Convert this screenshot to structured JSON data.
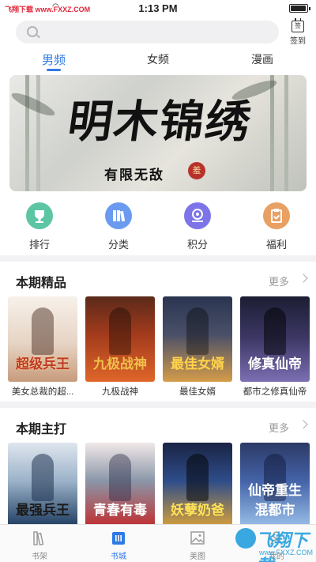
{
  "status_bar": {
    "carrier": "飞翔下载 www.FXXZ.COM",
    "time": "1:13 PM"
  },
  "search": {
    "placeholder": "",
    "icon": "search-icon"
  },
  "checkin": {
    "icon_char": "签",
    "label": "签到"
  },
  "tabs": [
    {
      "label": "男频",
      "active": true
    },
    {
      "label": "女频",
      "active": false
    },
    {
      "label": "漫画",
      "active": false
    }
  ],
  "banner": {
    "title": "明木锦绣",
    "author_line": "有限无敌",
    "seal": "羞"
  },
  "quick_nav": [
    {
      "label": "排行",
      "icon": "trophy-icon",
      "color": "#5cc6a4"
    },
    {
      "label": "分类",
      "icon": "books-icon",
      "color": "#6b9bf0"
    },
    {
      "label": "积分",
      "icon": "points-icon",
      "color": "#7d74e8"
    },
    {
      "label": "福利",
      "icon": "gift-clipboard-icon",
      "color": "#e8a064"
    }
  ],
  "sections": [
    {
      "title": "本期精品",
      "more": "更多",
      "books": [
        {
          "name": "美女总裁的超...",
          "cover_title": "超级兵王"
        },
        {
          "name": "九极战神",
          "cover_title": "九极战神"
        },
        {
          "name": "最佳女婿",
          "cover_title": "最佳女婿"
        },
        {
          "name": "都市之修真仙帝",
          "cover_title": "修真仙帝"
        }
      ]
    },
    {
      "title": "本期主打",
      "more": "更多",
      "books": [
        {
          "name": "",
          "cover_title": "最强兵王"
        },
        {
          "name": "",
          "cover_title": "青春有毒"
        },
        {
          "name": "",
          "cover_title": "妖孽奶爸"
        },
        {
          "name": "",
          "cover_title": "仙帝重生混都市"
        }
      ]
    }
  ],
  "bottom_nav": [
    {
      "label": "书架",
      "icon": "bookshelf-icon",
      "active": false
    },
    {
      "label": "书城",
      "icon": "bookstore-icon",
      "active": true
    },
    {
      "label": "美图",
      "icon": "image-icon",
      "active": false
    },
    {
      "label": "我的",
      "icon": "profile-icon",
      "active": false
    }
  ],
  "watermark": {
    "text": "飞翔下载",
    "url": "www.FXXZ.COM"
  },
  "colors": {
    "accent": "#2f7ae5",
    "divider": "#f2f2f4"
  }
}
